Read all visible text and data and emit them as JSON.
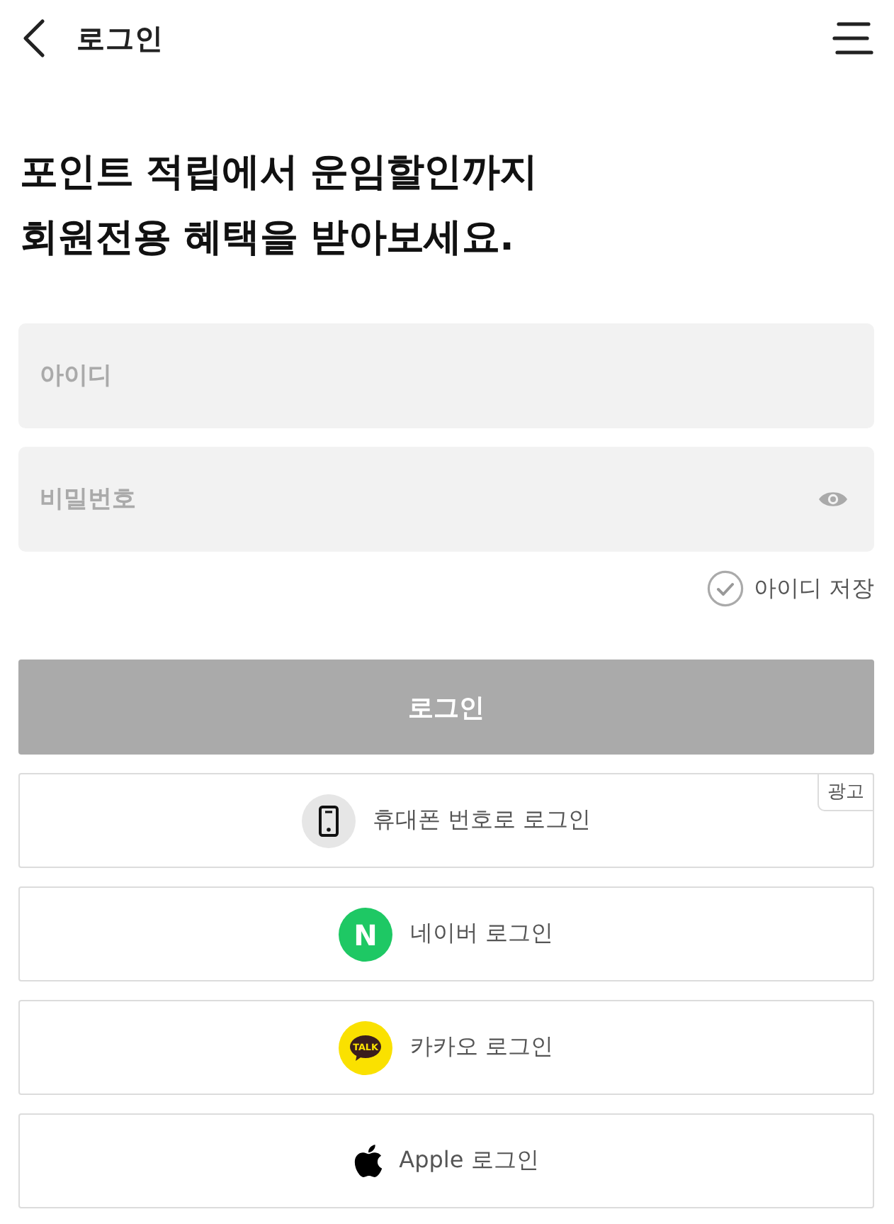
{
  "header": {
    "title": "로그인"
  },
  "headline": {
    "lines": [
      "포인트 적립에서 운임할인까지",
      "회원전용 혜택을 받아보세요."
    ]
  },
  "fields": [
    {
      "kind": "text",
      "placeholder": "아이디"
    },
    {
      "kind": "password",
      "placeholder": "비밀번호"
    }
  ],
  "remember_id": {
    "label": "아이디 저장",
    "checked": false
  },
  "login_button": {
    "label": "로그인",
    "disabled": true
  },
  "login_options": [
    {
      "kind": "phone",
      "label": "휴대폰 번호로 로그인",
      "badge": "광고"
    },
    {
      "kind": "naver",
      "label": "네이버 로그인",
      "icon_text": "N"
    },
    {
      "kind": "kakao",
      "label": "카카오 로그인",
      "icon_text": "TALK"
    },
    {
      "kind": "apple",
      "label": "Apple 로그인"
    }
  ]
}
